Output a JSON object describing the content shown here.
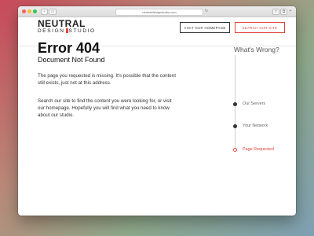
{
  "browser": {
    "url": "neutraldesignstudio.com"
  },
  "header": {
    "logo_top": "NEUTRAL",
    "logo_left": "DESIGN",
    "logo_right": "STUDIO",
    "home_button": "VISIT OUR HOMEPAGE",
    "search_button": "SEARCH OUR SITE"
  },
  "error": {
    "title": "Error 404",
    "subtitle": "Document Not Found",
    "paragraph1": "The page you requested is missing. It's possible that the content still exists, just not at this address.",
    "paragraph2": "Search our site to find the content you were looking for, or visit our homepage. Hopefully you will find what you need to know about our studio."
  },
  "sidebar": {
    "heading": "What's Wrong?",
    "steps": [
      {
        "label": "Our Servers",
        "active": false
      },
      {
        "label": "Your Network",
        "active": false
      },
      {
        "label": "Page Requested",
        "active": true
      }
    ]
  },
  "colors": {
    "accent": "#e2453c",
    "text": "#222222"
  }
}
